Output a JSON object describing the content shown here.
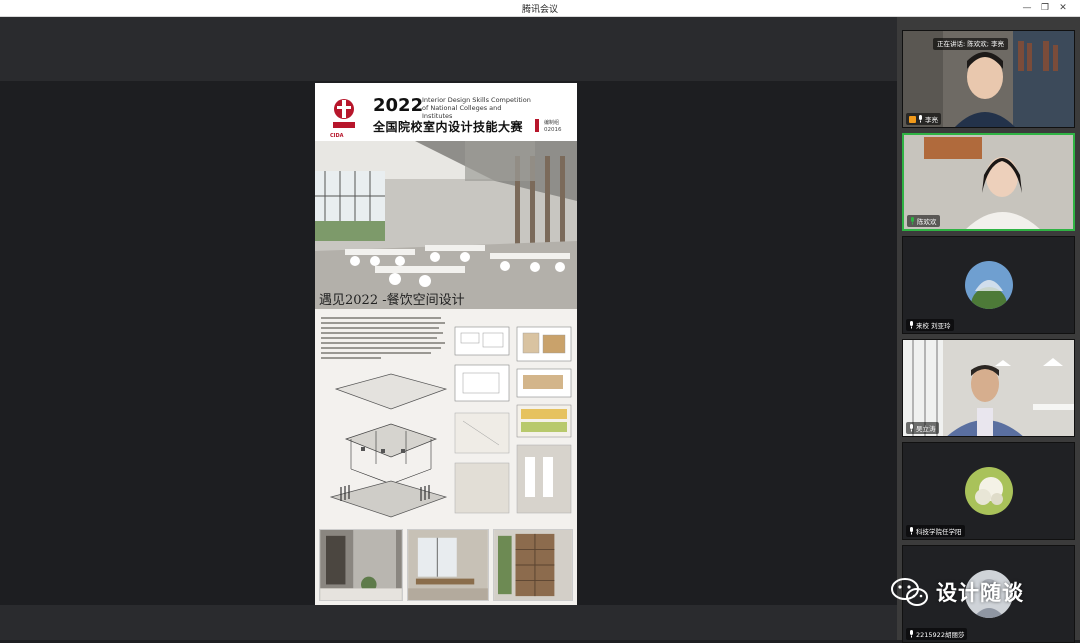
{
  "window": {
    "title": "腾讯会议",
    "controls": [
      "—",
      "❐",
      "✕"
    ]
  },
  "poster": {
    "year": "2022",
    "competition_en": "Interior Design Skills Competition of National Colleges and Institutes",
    "competition_cn": "全国院校室内设计技能大赛",
    "logo_text": "CIDA",
    "code_label": "编制组",
    "code_value": "02016",
    "subtitle": "遇见2022 -餐饮空间设计"
  },
  "participants": {
    "speaking_label": "正在讲话: 陈欢欢; 李亮",
    "tiles": [
      {
        "name": "李亮",
        "type": "video"
      },
      {
        "name": "陈欢欢",
        "type": "video"
      },
      {
        "name": "来校 刘亚玲",
        "type": "avatar"
      },
      {
        "name": "吴立涛",
        "type": "video"
      },
      {
        "name": "科技学院任学阳",
        "type": "avatar"
      },
      {
        "name": "2215922胡丽莎",
        "type": "avatar"
      }
    ]
  },
  "watermark": {
    "text": "设计随谈",
    "icon": "wechat-icon"
  },
  "colors": {
    "accent_green": "#2fb344",
    "cida_red": "#b7162b"
  }
}
